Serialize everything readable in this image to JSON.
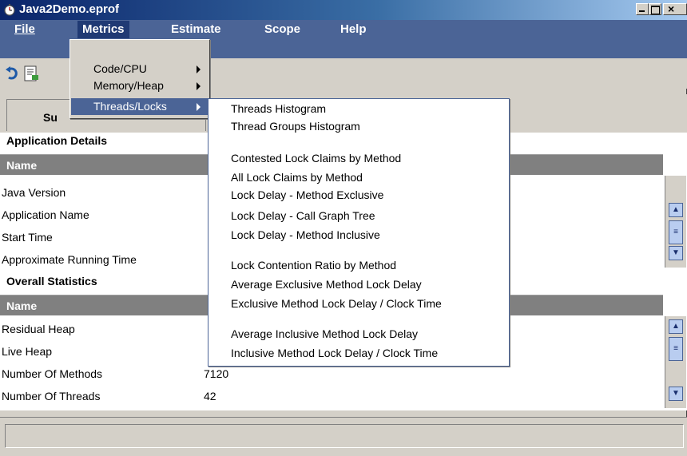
{
  "window": {
    "title": "Java2Demo.eprof"
  },
  "menubar": {
    "items": [
      {
        "label": "File"
      },
      {
        "label": "Metrics"
      },
      {
        "label": "Estimate"
      },
      {
        "label": "Scope"
      },
      {
        "label": "Help"
      }
    ]
  },
  "metrics_menu": {
    "items": [
      {
        "label": "Code/CPU"
      },
      {
        "label": "Memory/Heap"
      },
      {
        "label": "Threads/Locks"
      }
    ]
  },
  "threads_submenu": {
    "items": [
      "Threads Histogram",
      "Thread Groups Histogram",
      "Contested Lock Claims by Method",
      "All Lock Claims by Method",
      "Lock Delay - Method Exclusive",
      "Lock Delay - Call Graph Tree",
      "Lock Delay - Method Inclusive",
      "Lock Contention Ratio by Method",
      "Average Exclusive Method Lock Delay",
      "Exclusive Method Lock Delay / Clock Time",
      "Average Inclusive Method Lock Delay",
      "Inclusive Method Lock Delay / Clock Time"
    ]
  },
  "tabs": {
    "summary_label": "Su"
  },
  "application_details": {
    "title": "Application Details",
    "header": "Name",
    "rows": [
      {
        "label": "Java Version",
        "value": ""
      },
      {
        "label": "Application Name",
        "value": ""
      },
      {
        "label": "Start Time",
        "value": ""
      },
      {
        "label": "Approximate Running Time",
        "value": ""
      }
    ]
  },
  "overall_statistics": {
    "title": "Overall Statistics",
    "header": "Name",
    "rows": [
      {
        "label": "Residual Heap",
        "value": ""
      },
      {
        "label": "Live Heap",
        "value": ""
      },
      {
        "label": "Number Of Methods",
        "value": "7120"
      },
      {
        "label": "Number Of Threads",
        "value": "42"
      }
    ]
  },
  "colors": {
    "menubar": "#4b6496",
    "menu_highlight": "#4b6496",
    "title_gradient_start": "#0a246a",
    "header_gray": "#808080"
  }
}
